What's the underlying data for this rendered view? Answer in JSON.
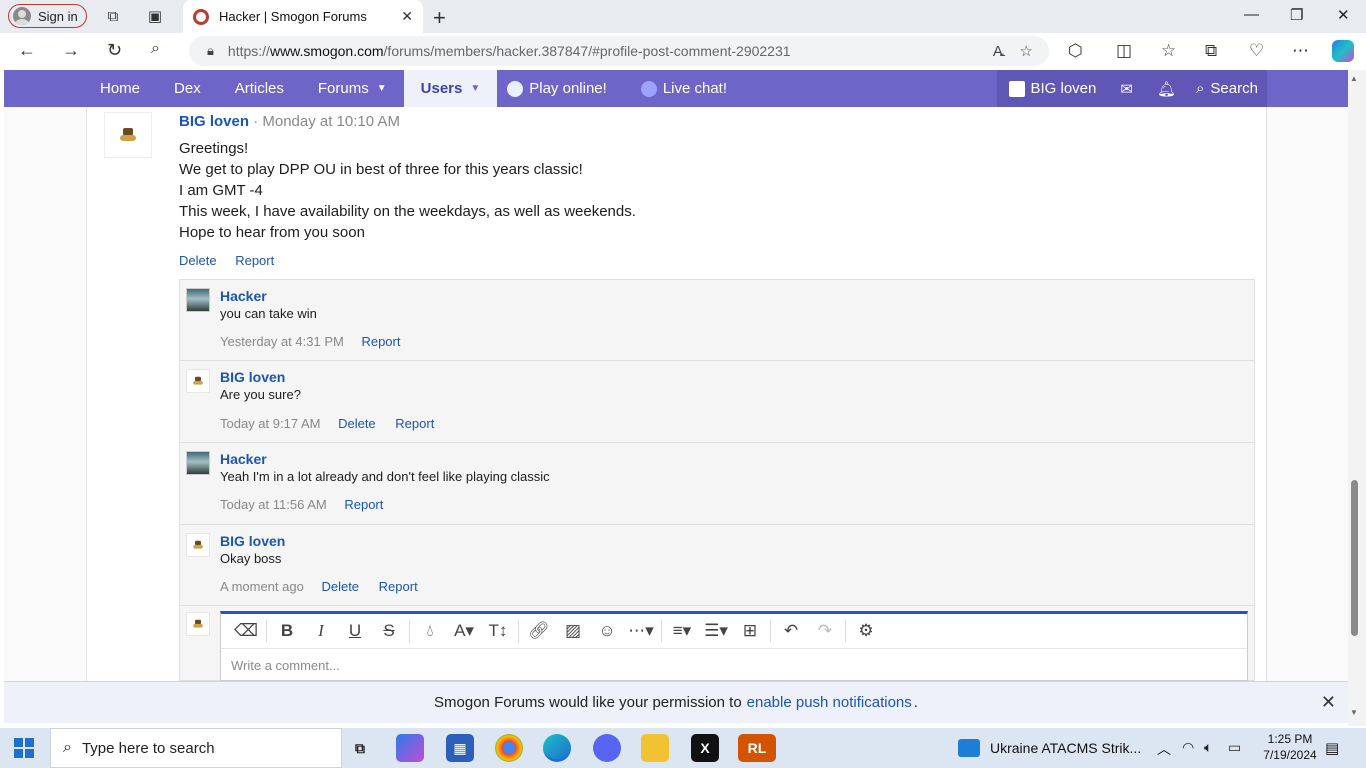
{
  "browser": {
    "signin_label": "Sign in",
    "tab_title": "Hacker | Smogon Forums",
    "url_prefix": "https://",
    "url_host": "www.smogon.com",
    "url_path": "/forums/members/hacker.387847/#profile-post-comment-2902231"
  },
  "sitenav": {
    "items": [
      "Home",
      "Dex",
      "Articles",
      "Forums",
      "Users",
      "Play online!",
      "Live chat!"
    ],
    "user_name": "BIG loven",
    "search_label": "Search"
  },
  "post": {
    "author": "BIG loven",
    "time": "· Monday at 10:10 AM",
    "lines": [
      "Greetings!",
      "We get to play DPP OU in best of three for this years classic!",
      "I am GMT -4",
      "This week, I have availability on the weekdays, as well as weekends.",
      "Hope to hear from you soon"
    ],
    "delete_label": "Delete",
    "report_label": "Report"
  },
  "comments": [
    {
      "author": "Hacker",
      "text": "you can take win",
      "time": "Yesterday at 4:31 PM",
      "actions": [
        "Report"
      ]
    },
    {
      "author": "BIG loven",
      "text": "Are you sure?",
      "time": "Today at 9:17 AM",
      "actions": [
        "Delete",
        "Report"
      ]
    },
    {
      "author": "Hacker",
      "text": "Yeah I'm in a lot already and don't feel like playing classic",
      "time": "Today at 11:56 AM",
      "actions": [
        "Report"
      ]
    },
    {
      "author": "BIG loven",
      "text": "Okay boss",
      "time": "A moment ago",
      "actions": [
        "Delete",
        "Report"
      ]
    }
  ],
  "editor": {
    "placeholder": "Write a comment...",
    "tools": [
      "eraser-icon",
      "bold-icon",
      "italic-icon",
      "underline-icon",
      "strikethrough-icon",
      "color-icon",
      "font-family-icon",
      "font-size-icon",
      "link-icon",
      "image-icon",
      "emoji-icon",
      "more-icon",
      "align-icon",
      "list-icon",
      "table-icon",
      "undo-icon",
      "redo-icon",
      "settings-icon"
    ]
  },
  "notice": {
    "text": "Smogon Forums would like your permission to",
    "link": "enable push notifications",
    "end": "."
  },
  "taskbar": {
    "search_placeholder": "Type here to search",
    "news": "Ukraine ATACMS Strik...",
    "time": "1:25 PM",
    "date": "7/19/2024"
  },
  "colors": {
    "nav_bg": "#6d65c7",
    "link": "#1b55b5",
    "editor_accent": "#2357b5"
  }
}
